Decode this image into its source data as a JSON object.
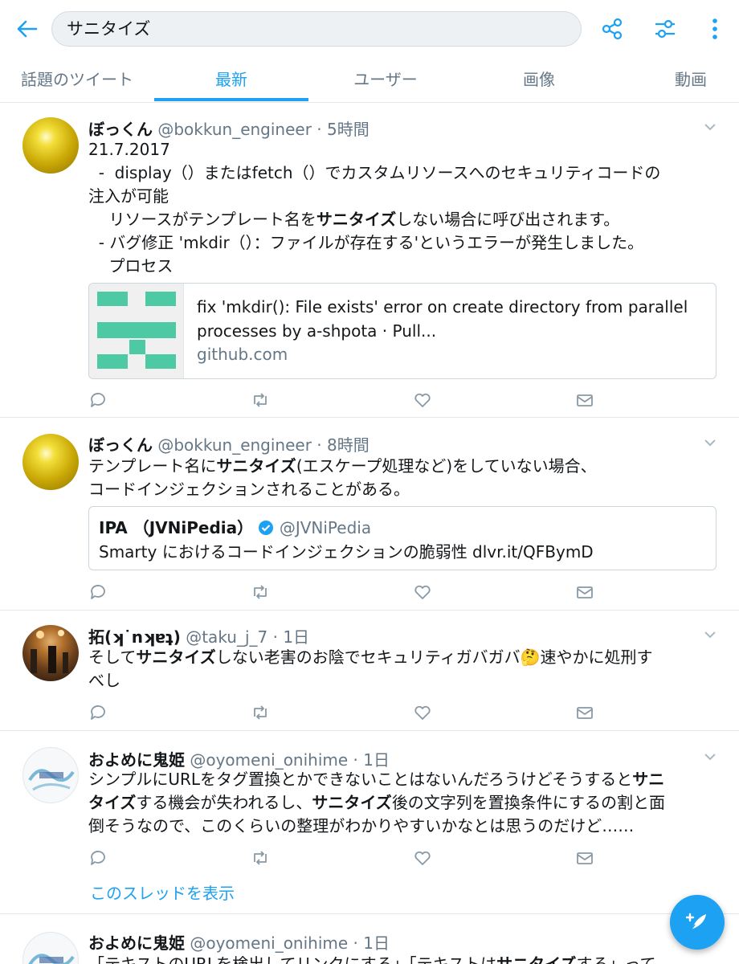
{
  "search": {
    "query": "サニタイズ"
  },
  "tabs": [
    {
      "label": "話題のツイート"
    },
    {
      "label": "最新"
    },
    {
      "label": "ユーザー"
    },
    {
      "label": "画像"
    },
    {
      "label": "動画"
    }
  ],
  "active_tab": "最新",
  "tweets": [
    {
      "name": "ぼっくん",
      "handle": "@bokkun_engineer",
      "time": "· 5時間",
      "lines": [
        "21.7.2017",
        "  -  display（）またはfetch（）でカスタムリソースへのセキュリティコードの",
        "注入が可能",
        "    リソースがテンプレート名を",
        "サニタイズ",
        "しない場合に呼び出されます。",
        "  - バグ修正 'mkdir（）：ファイルが存在する'というエラーが発生しました。",
        "    プロセス"
      ],
      "card": {
        "title": "fix 'mkdir(): File exists' error on create directory from parallel processes by a-shpota · Pull...",
        "domain": "github.com"
      }
    },
    {
      "name": "ぼっくん",
      "handle": "@bokkun_engineer",
      "time": "· 8時間",
      "text_pre": "テンプレート名に",
      "text_bold": "サニタイズ",
      "text_post": "(エスケープ処理など)をしていない場合、",
      "text_line2": "コードインジェクションされることがある。",
      "quote": {
        "name": "IPA （JVNiPedia）",
        "handle": "@JVNiPedia",
        "text": "Smarty におけるコードインジェクションの脆弱性 dlvr.it/QFBymD"
      }
    },
    {
      "name": "拓(ʞ˙nʞɐʇ)",
      "handle": "@taku_j_7",
      "time": "· 1日",
      "text_pre": "そして",
      "text_bold": "サニタイズ",
      "text_post": "しない老害のお陰でセキュリティガバガバ🤔速やかに処刑す",
      "text_line2": "べし"
    },
    {
      "name": "およめに鬼姫",
      "handle": "@oyomeni_onihime",
      "time": "· 1日",
      "l1_pre": "シンプルにURLをタグ置換とかできないことはないんだろうけどそうすると",
      "l1_bold": "サニ",
      "l2_bold": "タイズ",
      "l2_mid": "する機会が失われるし、",
      "l2_bold2": "サニタイズ",
      "l2_post": "後の文字列を置換条件にするの割と面",
      "l3": "倒そうなので、このくらいの整理がわかりやすいかなとは思うのだけど……",
      "thread_link": "このスレッドを表示"
    },
    {
      "name": "およめに鬼姫",
      "handle": "@oyomeni_onihime",
      "time": "· 1日",
      "text_pre": "「テキストのURLを検出してリンクにする」「テキストは",
      "text_bold": "サニタイズ",
      "text_post": "する」って"
    }
  ],
  "colors": {
    "accent": "#1da1f2",
    "text": "#14171a",
    "secondary": "#657786",
    "border": "#e1e8ed"
  }
}
